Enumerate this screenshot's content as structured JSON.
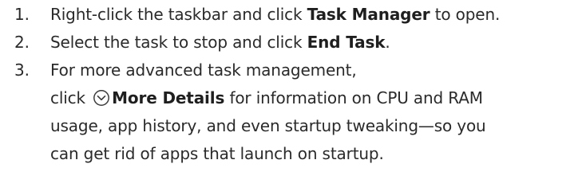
{
  "steps": [
    {
      "number": "1.",
      "text_before": "Right-click the taskbar and click ",
      "bold": "Task Manager",
      "text_after": " to open."
    },
    {
      "number": "2.",
      "text_before": "Select the task to stop and click ",
      "bold": "End Task",
      "text_after": "."
    },
    {
      "number": "3.",
      "line1": "For more advanced task management,",
      "line2_before": "click ",
      "icon": "chevron-down-circle-icon",
      "bold": "More Details",
      "line2_after": " for information on CPU and RAM",
      "line3": "usage, app history, and even startup tweaking—so you",
      "line4": "can get rid of apps that launch on startup."
    }
  ]
}
